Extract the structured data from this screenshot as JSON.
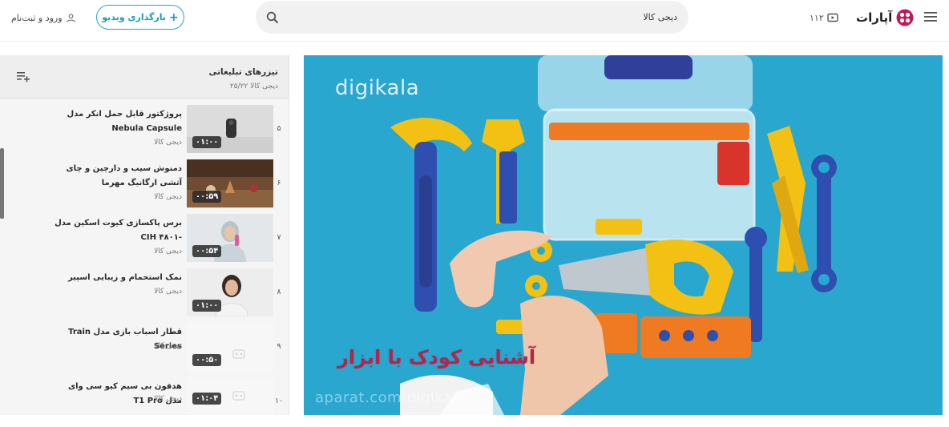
{
  "header": {
    "login_label": "ورود و ثبت‌نام",
    "upload_label": "بارگذاری ویدیو",
    "search_value": "دیجی کالا",
    "count": "۱۱۲",
    "logo_text": "آپارات"
  },
  "playlist": {
    "title": "تیزرهای تبلیغاتی",
    "subtitle": "دیجی کالا ۲۵/۲۲",
    "items": [
      {
        "index": "۵",
        "title": "پروژکتور قابل حمل انکر مدل Nebula Capsule",
        "channel": "دیجی کالا",
        "duration": "۰۱:۰۰"
      },
      {
        "index": "۶",
        "title": "دمنوش سیب و دارچین و چای آتشی ارگانیگ مهرما",
        "channel": "دیجی کالا",
        "duration": "۰۰:۵۹"
      },
      {
        "index": "۷",
        "title": "برس پاکسازی کیوت اسکین مدل -CIH ۴۸۰۱",
        "channel": "دیجی کالا",
        "duration": "۰۰:۵۴"
      },
      {
        "index": "۸",
        "title": "نمک استحمام و زیبایی اسپیر",
        "channel": "دیجی کالا",
        "duration": "۰۱:۰۰"
      },
      {
        "index": "۹",
        "title": "قطار اسباب بازی مدل Train Series",
        "channel": "دیجی کالا",
        "duration": "۰۰:۵۰"
      },
      {
        "index": "۱۰",
        "title": "هدفون بی سیم کیو سی وای مدل T1 Pro",
        "channel": "دیجی کالا",
        "duration": "۰۱:۰۴"
      }
    ]
  },
  "player": {
    "brand": "digikala",
    "caption": "آشنایی کودک با ابزار",
    "watermark": "aparat.com/digikala"
  },
  "colors": {
    "accent": "#21a7c4",
    "logo": "#c2185b",
    "caption": "#b8234a",
    "video_bg": "#2aa7cf"
  }
}
